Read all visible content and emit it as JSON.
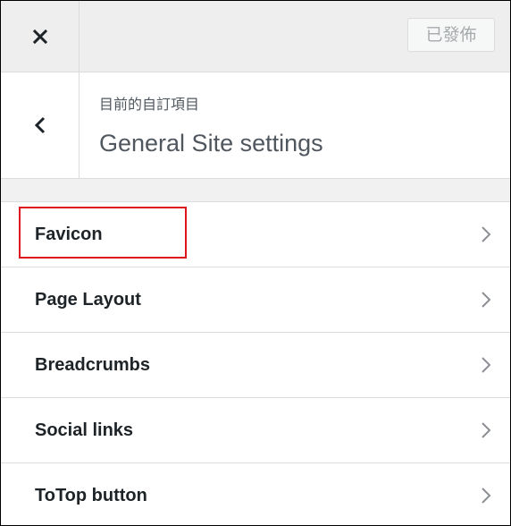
{
  "topbar": {
    "close_icon": "close-icon",
    "publish_label": "已發佈"
  },
  "header": {
    "back_icon": "chevron-left-icon",
    "breadcrumb": "目前的自訂項目",
    "title": "General Site settings"
  },
  "sections": [
    {
      "label": "Favicon",
      "icon": "chevron-right-icon"
    },
    {
      "label": "Page Layout",
      "icon": "chevron-right-icon"
    },
    {
      "label": "Breadcrumbs",
      "icon": "chevron-right-icon"
    },
    {
      "label": "Social links",
      "icon": "chevron-right-icon"
    },
    {
      "label": "ToTop button",
      "icon": "chevron-right-icon"
    }
  ],
  "annotation": {
    "color": "#e0141e"
  }
}
